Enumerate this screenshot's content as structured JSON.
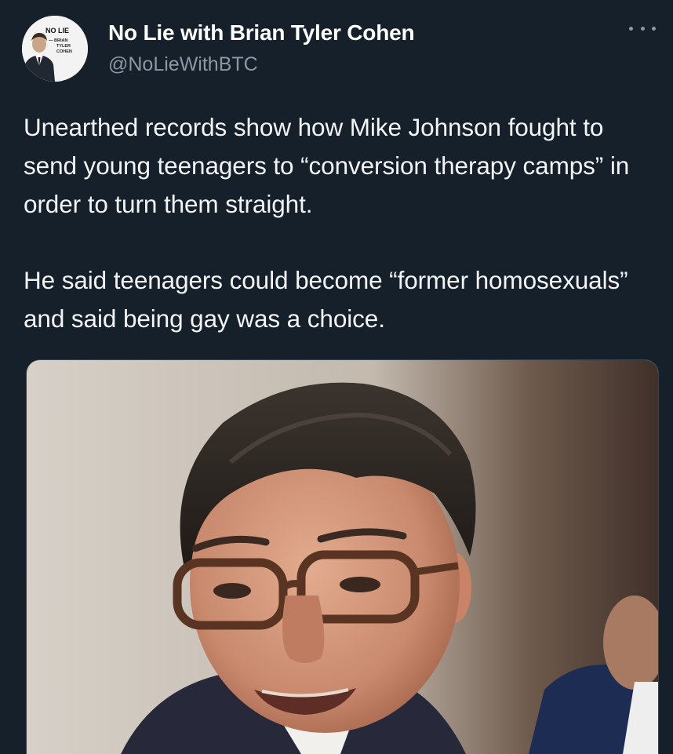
{
  "author": {
    "display_name": "No Lie with Brian Tyler Cohen",
    "handle": "@NoLieWithBTC",
    "avatar_logo_lines": [
      "NO LIE",
      "— BRIAN",
      "TYLER",
      "COHEN"
    ]
  },
  "tweet": {
    "paragraphs": [
      "Unearthed records show how Mike Johnson fought to send young teenagers to “conversion therapy camps” in order to turn them straight.",
      "He said teenagers could become “former homosexuals” and said being gay was a choice."
    ]
  },
  "media": {
    "icon": "photo"
  },
  "icons": {
    "more": "more-horizontal-icon"
  },
  "colors": {
    "background": "#15202b",
    "text": "#ffffff",
    "secondary_text": "#8b98a5",
    "border": "#38444d"
  }
}
